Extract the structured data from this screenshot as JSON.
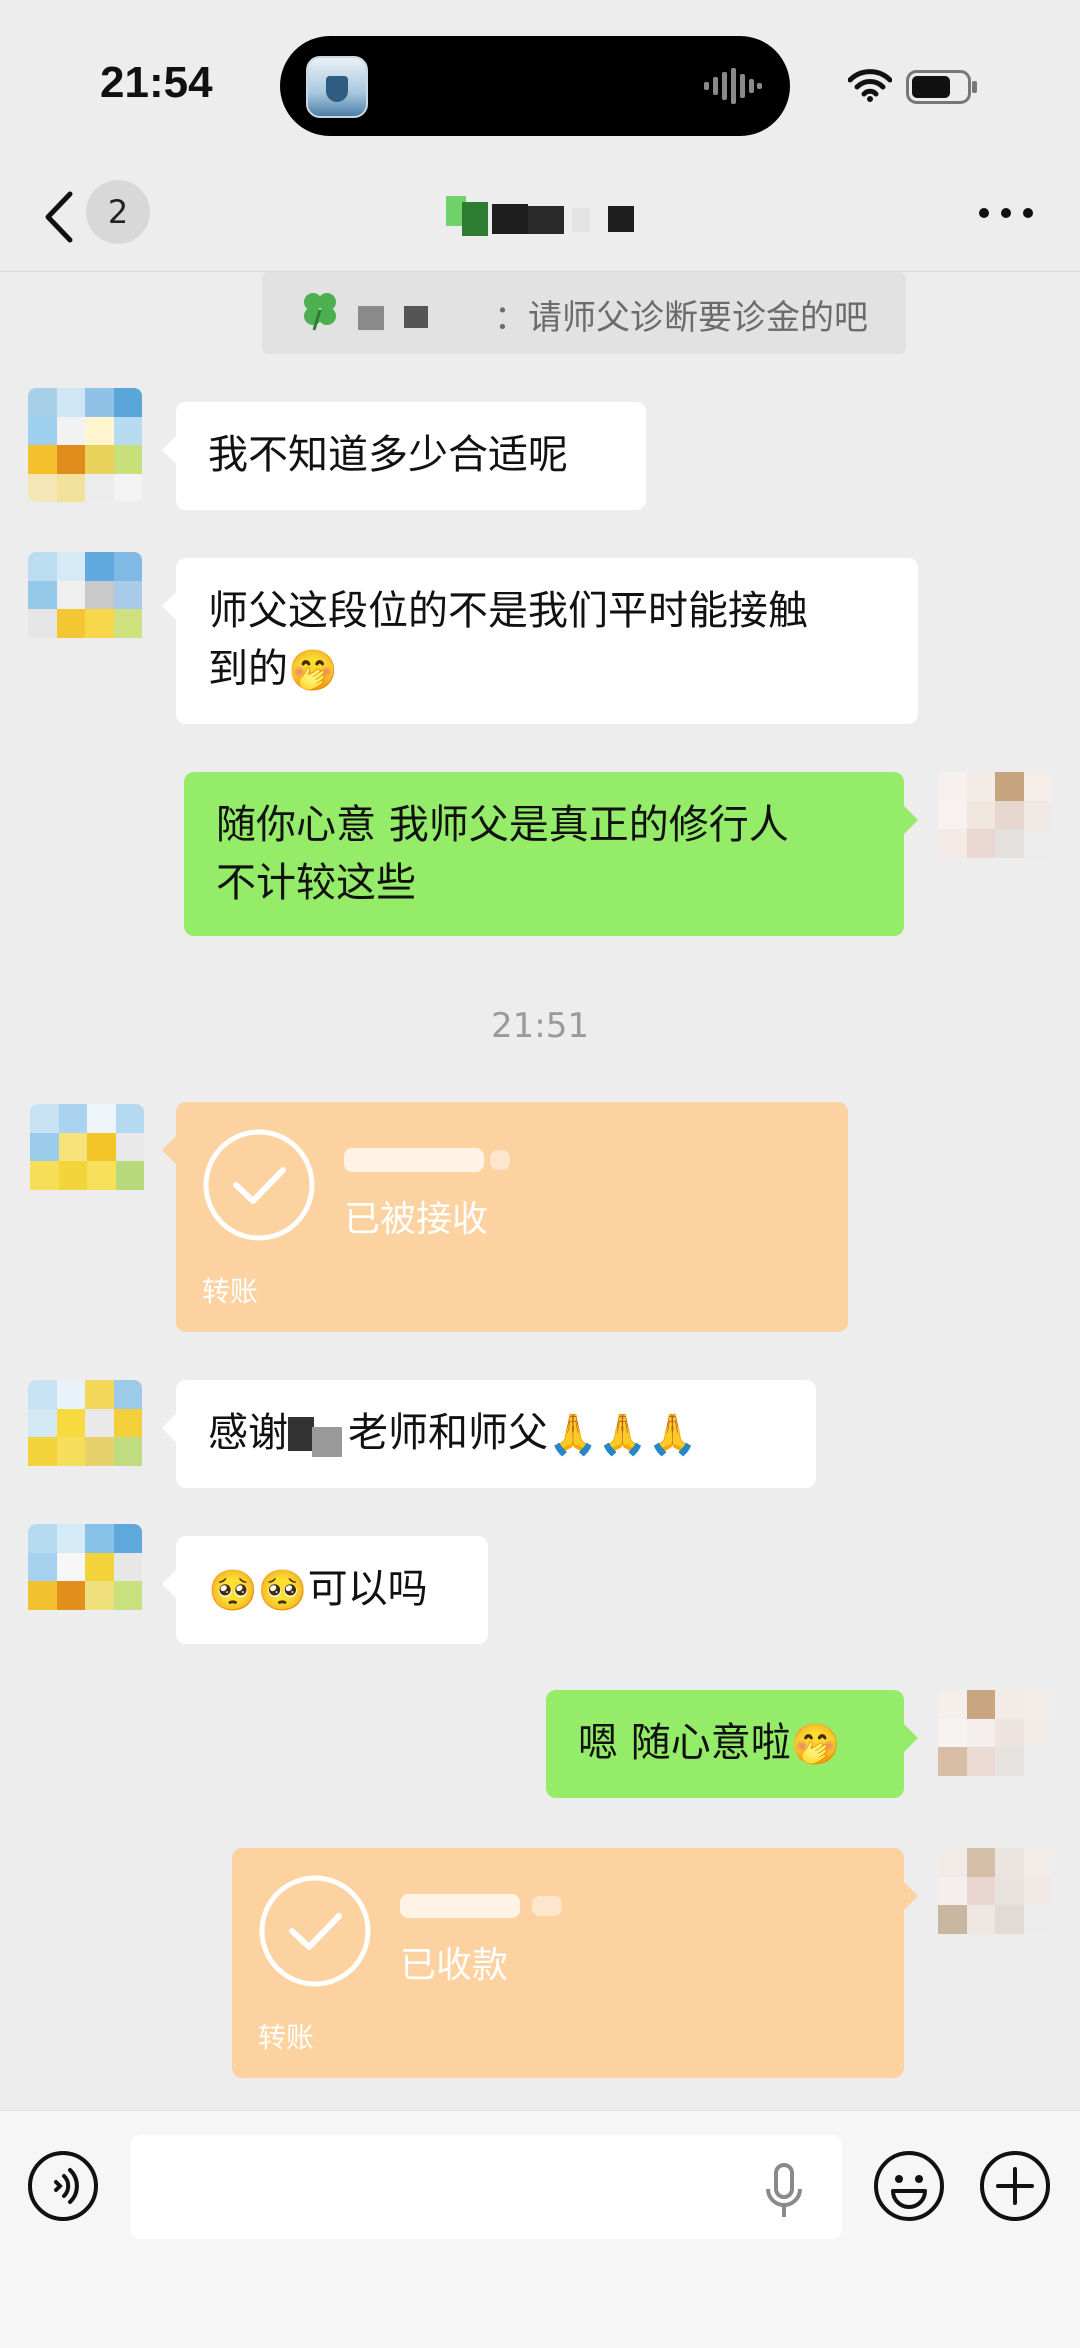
{
  "status_bar": {
    "time": "21:54"
  },
  "nav": {
    "unread_count": "2",
    "chat_title": ""
  },
  "quote": {
    "text": "：请师父诊断要诊金的吧"
  },
  "messages": {
    "m1": {
      "text": "我不知道多少合适呢"
    },
    "m2": {
      "text": "师父这段位的不是我们平时能接触\n到的",
      "emoji": "🤭"
    },
    "m3": {
      "text": "随你心意 我师父是真正的修行人\n不计较这些"
    },
    "time_divider": "21:51",
    "transfer_in": {
      "status": "已被接收",
      "label": "转账",
      "amount": ""
    },
    "m5": {
      "pre": "感谢",
      "post": "老师和师父",
      "emoji": "🙏🙏🙏"
    },
    "m6": {
      "emoji": "🥺🥺",
      "text": "可以吗"
    },
    "m7": {
      "text": "嗯 随心意啦",
      "emoji": "🤭"
    },
    "transfer_out": {
      "status": "已收款",
      "label": "转账",
      "amount": ""
    }
  },
  "input": {
    "placeholder": "",
    "value": ""
  },
  "colors": {
    "background": "#ededed",
    "bubble_in": "#ffffff",
    "bubble_out": "#95ec69",
    "transfer": "#fcd2a0",
    "timestamp": "#9a9a9a"
  },
  "icons": [
    "back-icon",
    "wifi-icon",
    "battery-icon",
    "more-icon",
    "voice-icon",
    "mic-icon",
    "emoji-icon",
    "plus-icon",
    "check-circle-icon",
    "clover-icon"
  ]
}
